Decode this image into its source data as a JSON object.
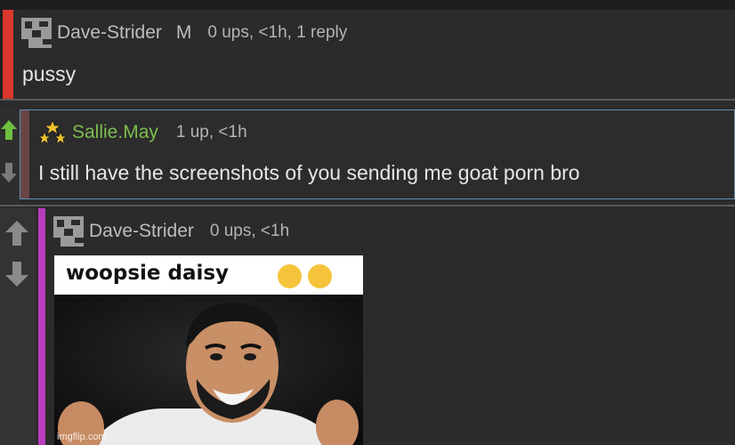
{
  "thread": {
    "comments": [
      {
        "username": "Dave-Strider",
        "flag": "M",
        "meta": "0 ups, <1h, 1 reply",
        "text": "pussy",
        "bar_color": "#d9382c"
      },
      {
        "username": "Sallie.May",
        "meta": "1 up, <1h",
        "text": "I still have the screenshots of you sending me goat porn bro",
        "bar_color": "#6b4545",
        "username_color": "#7dbd4f",
        "upvoted": true
      },
      {
        "username": "Dave-Strider",
        "meta": "0 ups, <1h",
        "image_caption": "woopsie daisy",
        "bar_color": "#b83dbd"
      }
    ]
  },
  "watermark": "imgflip.com",
  "icons": {
    "upvote": "arrow-up-icon",
    "downvote": "arrow-down-icon",
    "avatar": "pixel-avatar-icon",
    "rank": "stars-rank-icon",
    "emoji": "tears-of-joy-emoji"
  }
}
